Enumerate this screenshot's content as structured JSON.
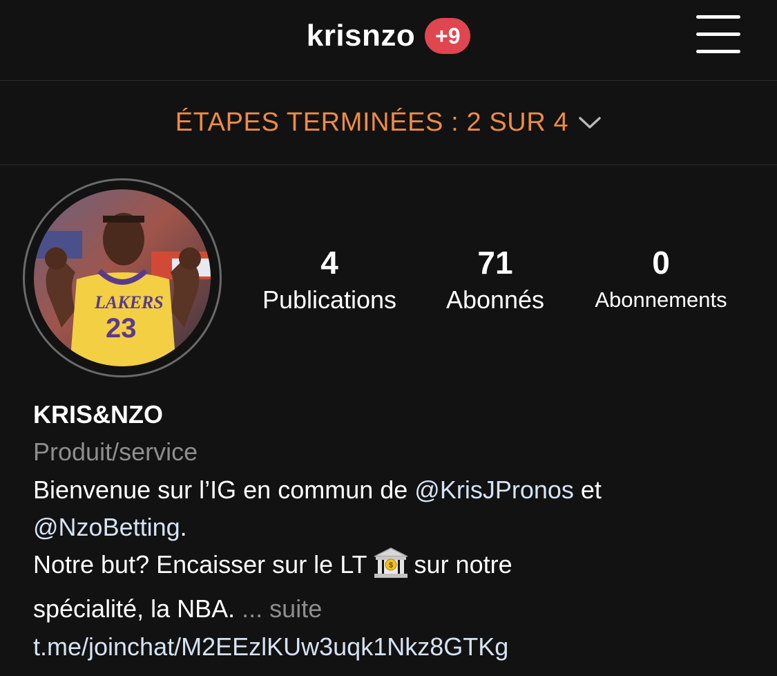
{
  "header": {
    "username": "krisnzo",
    "notification_badge": "+9",
    "badge_color": "#e0464f",
    "menu_icon": "hamburger-menu-icon"
  },
  "steps_banner": {
    "text": "ÉTAPES TERMINÉES : 2 SUR 4",
    "completed": 2,
    "total": 4,
    "color": "#ed8c46",
    "icon": "chevron-down-icon"
  },
  "profile": {
    "avatar": "profile-photo",
    "stats": [
      {
        "value": "4",
        "label": "Publications"
      },
      {
        "value": "71",
        "label": "Abonnés"
      },
      {
        "value": "0",
        "label": "Abonnements"
      }
    ]
  },
  "bio": {
    "name": "KRIS&NZO",
    "category": "Produit/service",
    "line1_before": "Bienvenue sur l’IG en commun de ",
    "mention1": "@KrisJPronos",
    "line1_after": " et",
    "mention2": "@NzoBetting",
    "line2_after": ".",
    "line3_before": "Notre but? Encaisser sur le LT",
    "line3_emoji": "bank-icon",
    "line3_after": "sur notre",
    "line4": "spécialité, la NBA. ",
    "more_dots": "...",
    "more_label": "suite",
    "link": "t.me/joinchat/M2EEzlKUw3uqk1Nkz8GTKg",
    "link_color": "#d6e3f5"
  }
}
